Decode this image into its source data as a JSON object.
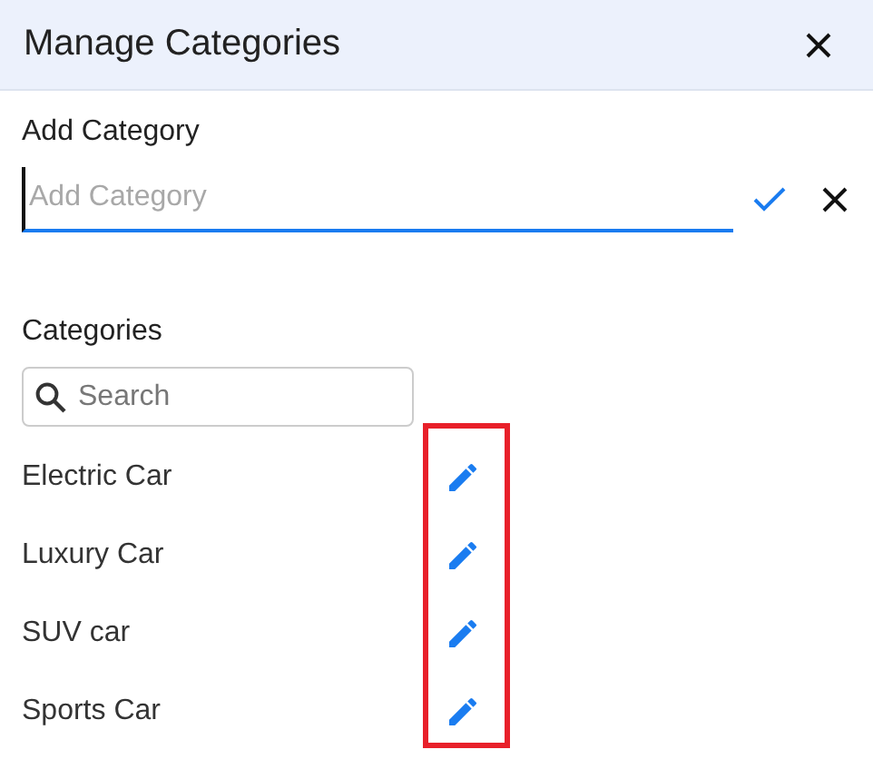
{
  "dialog": {
    "title": "Manage Categories"
  },
  "add_category": {
    "label": "Add Category",
    "placeholder": "Add Category",
    "focused": true
  },
  "categories": {
    "label": "Categories",
    "search": {
      "placeholder": "Search"
    },
    "items": [
      {
        "name": "Electric Car"
      },
      {
        "name": "Luxury Car"
      },
      {
        "name": "SUV car"
      },
      {
        "name": "Sports Car"
      }
    ],
    "edit_icons_highlighted": true
  }
}
